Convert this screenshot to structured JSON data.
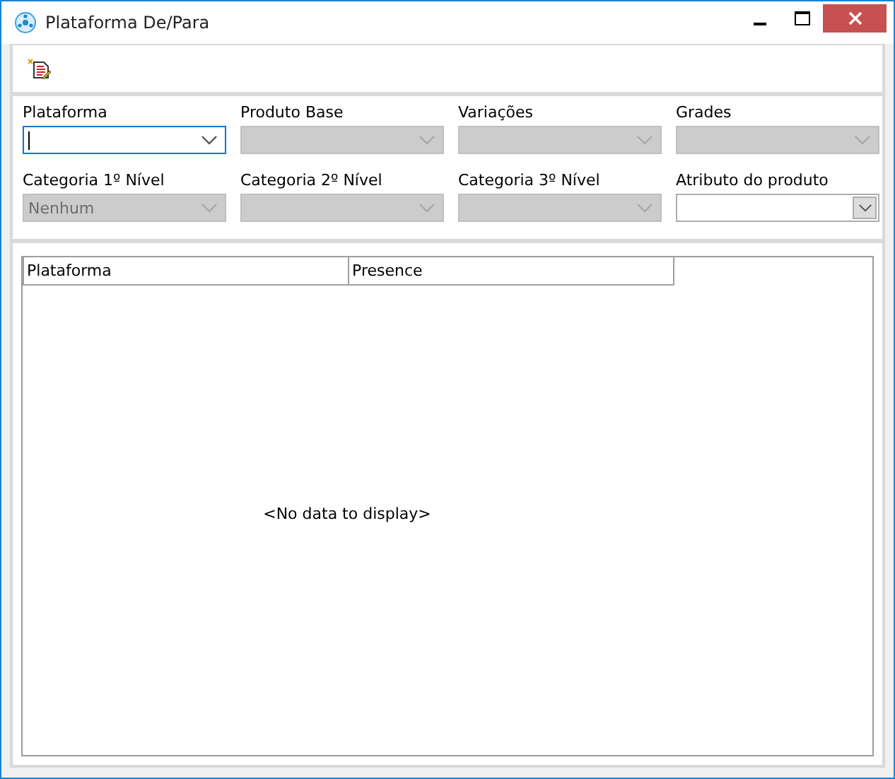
{
  "window": {
    "title": "Plataforma De/Para"
  },
  "filters": [
    {
      "label": "Plataforma",
      "kind": "plain",
      "disabled": false,
      "focused": true
    },
    {
      "label": "Produto Base",
      "kind": "plain",
      "disabled": true,
      "focused": false
    },
    {
      "label": "Variações",
      "kind": "plain",
      "disabled": true,
      "focused": false
    },
    {
      "label": "Grades",
      "kind": "plain",
      "disabled": true,
      "focused": false
    },
    {
      "label": "Categoria 1º Nível",
      "kind": "plain",
      "value": "Nenhum",
      "disabled": true,
      "focused": false
    },
    {
      "label": "Categoria 2º Nível",
      "kind": "plain",
      "disabled": true,
      "focused": false
    },
    {
      "label": "Categoria 3º Nível",
      "kind": "plain",
      "disabled": true,
      "focused": false
    },
    {
      "label": "Atributo do produto",
      "kind": "boxed",
      "disabled": false,
      "focused": false
    }
  ],
  "grid": {
    "columns": [
      "Plataforma",
      "Presence"
    ],
    "empty_text": "<No data to display>"
  }
}
